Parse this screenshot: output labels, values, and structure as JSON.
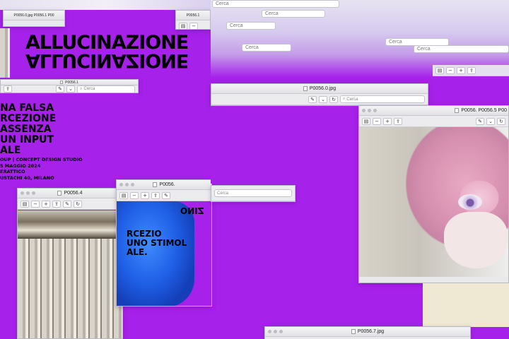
{
  "search_label": "Cerca",
  "windows": {
    "win_a": {
      "title": "P0056.0.jpg"
    },
    "win_b": {
      "title": "P0056.1"
    },
    "win_c": {
      "title": "P0056.4"
    },
    "win_d": {
      "title": "P0056."
    },
    "win_e": {
      "title": "P0056. P0056.5 P00"
    },
    "win_f": {
      "title": "P0056.7.jpg"
    },
    "top_left_strip": {
      "title": "P0056.0.jpg P0056.1 P00"
    }
  },
  "poster": {
    "title": "ALLUCINAZIONE",
    "lines": [
      "NA FALSA",
      "RCEZIONE",
      "ASSENZA",
      "UN INPUT",
      "ALE"
    ],
    "info": [
      "OUP | CONCEPT DESIGN STUDIO",
      "5 MAGGIO 2024",
      "ERATTICO",
      "USTACHI 40, MILANO"
    ],
    "fragment_lines": [
      "RCEZIO",
      "UNO STIMOL",
      "ALE."
    ],
    "mirrored_fragment": "ONIZ"
  },
  "icons": {
    "sidebar": "sidebar-icon",
    "zoom_out": "zoom-out-icon",
    "zoom_in": "zoom-in-icon",
    "share": "share-icon",
    "markup": "pen-icon",
    "rotate": "rotate-icon",
    "search": "magnifier-icon"
  }
}
